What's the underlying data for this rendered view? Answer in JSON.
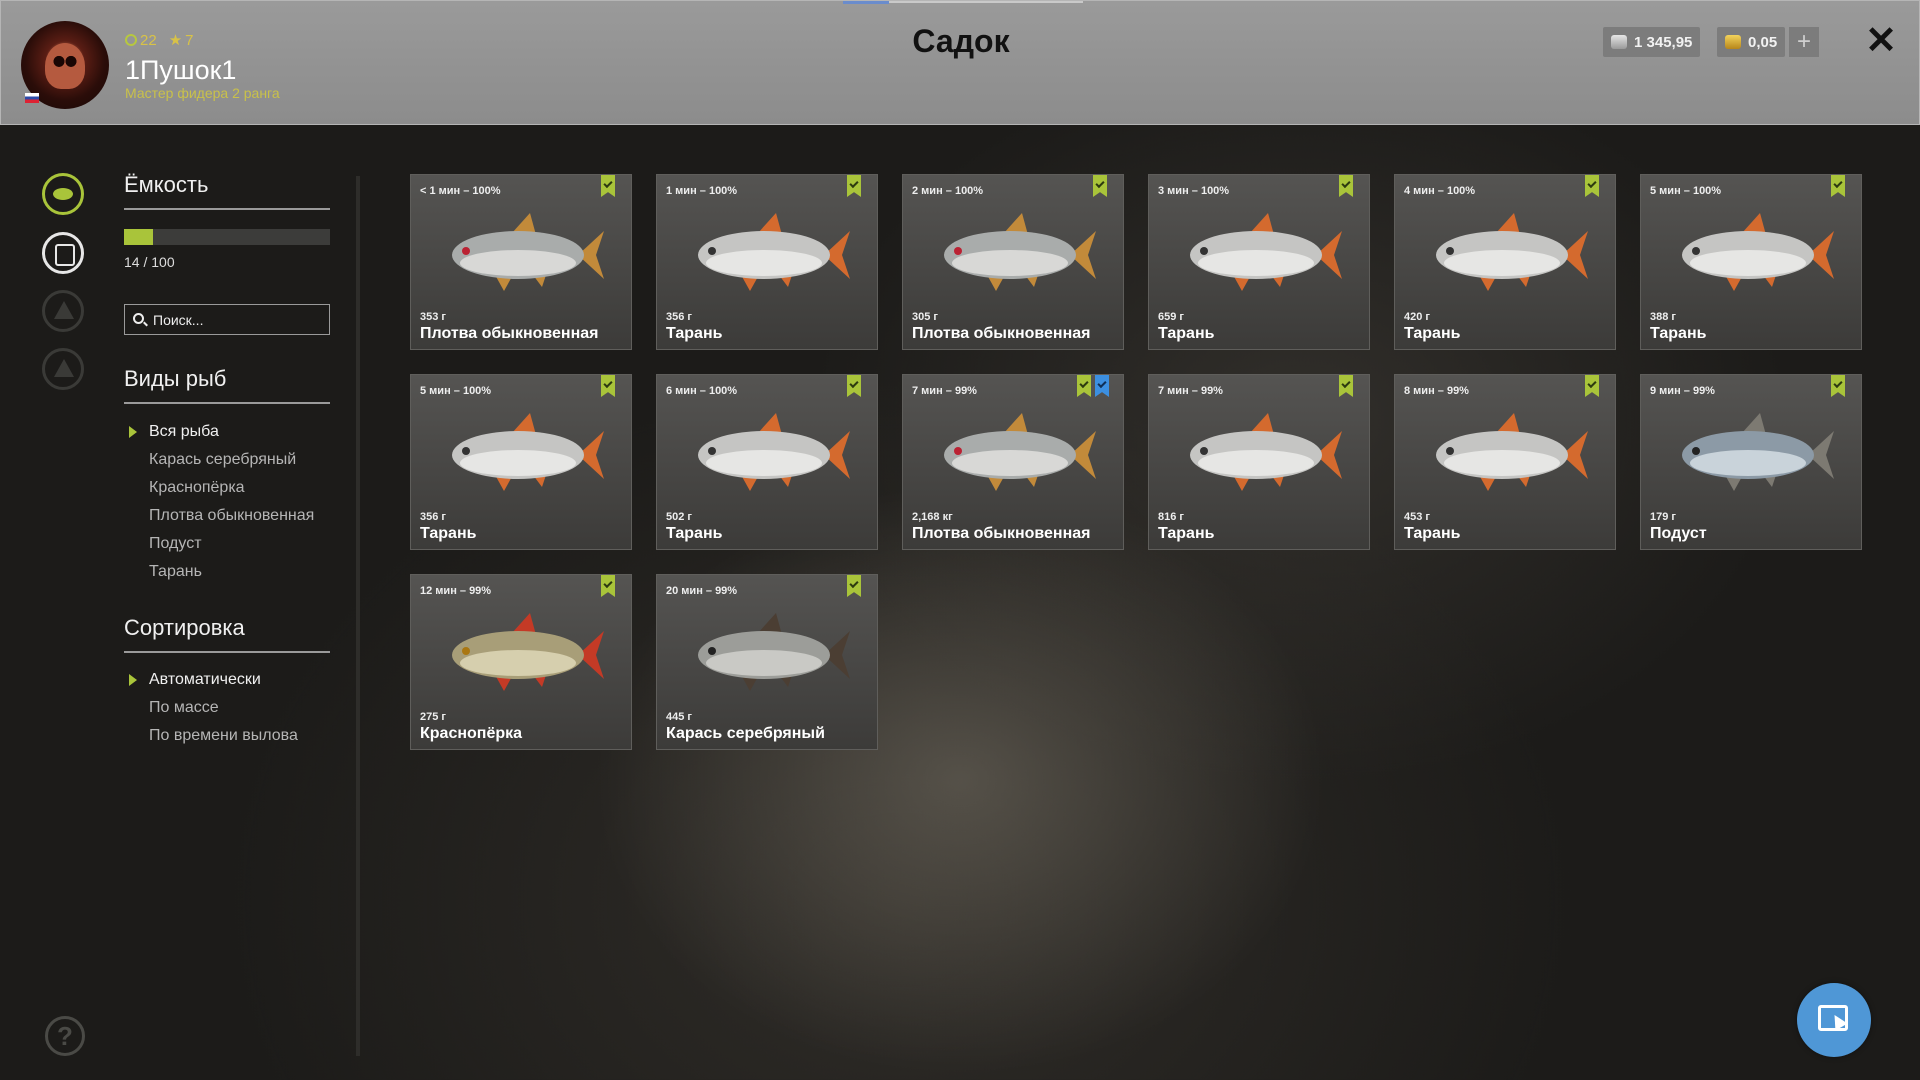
{
  "header": {
    "level": "22",
    "stars": "7",
    "username": "1Пушок1",
    "rank": "Мастер фидера 2 ранга",
    "title": "Садок",
    "silver": "1 345,95",
    "gold": "0,05",
    "add": "+",
    "close": "✕"
  },
  "left": {
    "capacity_title": "Ёмкость",
    "capacity_text": "14 / 100",
    "capacity_fraction": 0.14,
    "search_placeholder": "Поиск...",
    "species_title": "Виды рыб",
    "species": [
      "Вся рыба",
      "Карась серебряный",
      "Краснопёрка",
      "Плотва обыкновенная",
      "Подуст",
      "Тарань"
    ],
    "sort_title": "Сортировка",
    "sort": [
      "Автоматически",
      "По массе",
      "По времени вылова"
    ],
    "help": "?"
  },
  "colors": {
    "accent": "#a9c43a",
    "blue": "#4f97d6"
  },
  "fish": [
    {
      "time": "< 1 мин – 100%",
      "weight": "353 г",
      "name": "Плотва обыкновенная",
      "kind": "roach",
      "marks": [
        "green"
      ]
    },
    {
      "time": "1 мин – 100%",
      "weight": "356 г",
      "name": "Тарань",
      "kind": "taran",
      "marks": [
        "green"
      ]
    },
    {
      "time": "2 мин – 100%",
      "weight": "305 г",
      "name": "Плотва обыкновенная",
      "kind": "roach",
      "marks": [
        "green"
      ]
    },
    {
      "time": "3 мин – 100%",
      "weight": "659 г",
      "name": "Тарань",
      "kind": "taran",
      "marks": [
        "green"
      ]
    },
    {
      "time": "4 мин – 100%",
      "weight": "420 г",
      "name": "Тарань",
      "kind": "taran",
      "marks": [
        "green"
      ]
    },
    {
      "time": "5 мин – 100%",
      "weight": "388 г",
      "name": "Тарань",
      "kind": "taran",
      "marks": [
        "green"
      ]
    },
    {
      "time": "5 мин – 100%",
      "weight": "356 г",
      "name": "Тарань",
      "kind": "taran",
      "marks": [
        "green"
      ]
    },
    {
      "time": "6 мин – 100%",
      "weight": "502 г",
      "name": "Тарань",
      "kind": "taran",
      "marks": [
        "green"
      ]
    },
    {
      "time": "7 мин – 99%",
      "weight": "2,168 кг",
      "name": "Плотва обыкновенная",
      "kind": "roach",
      "marks": [
        "green",
        "blue"
      ]
    },
    {
      "time": "7 мин – 99%",
      "weight": "816 г",
      "name": "Тарань",
      "kind": "taran",
      "marks": [
        "green"
      ]
    },
    {
      "time": "8 мин – 99%",
      "weight": "453 г",
      "name": "Тарань",
      "kind": "taran",
      "marks": [
        "green"
      ]
    },
    {
      "time": "9 мин – 99%",
      "weight": "179 г",
      "name": "Подуст",
      "kind": "podust",
      "marks": [
        "green"
      ]
    },
    {
      "time": "12 мин – 99%",
      "weight": "275 г",
      "name": "Краснопёрка",
      "kind": "rudd",
      "marks": [
        "green"
      ]
    },
    {
      "time": "20 мин – 99%",
      "weight": "445 г",
      "name": "Карась серебряный",
      "kind": "carp",
      "marks": [
        "green"
      ]
    }
  ]
}
